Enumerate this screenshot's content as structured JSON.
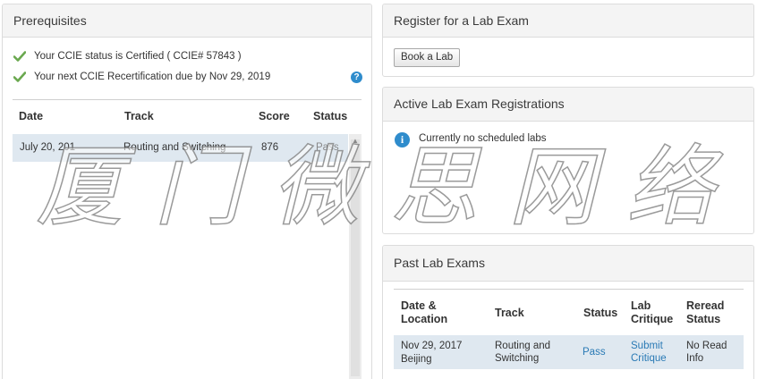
{
  "prerequisites": {
    "title": "Prerequisites",
    "status_line": "Your CCIE status is Certified ( CCIE# 57843 )",
    "recert_line": "Your next CCIE Recertification due by Nov 29, 2019",
    "help_icon": "question-icon",
    "table": {
      "headers": [
        "Date",
        "Track",
        "Score",
        "Status"
      ],
      "rows": [
        {
          "date": "July 20, 201",
          "track": "Routing and Switching",
          "score": "876",
          "status": "Pass"
        }
      ]
    }
  },
  "register": {
    "title": "Register for a Lab Exam",
    "book_button": "Book a Lab"
  },
  "active": {
    "title": "Active Lab Exam Registrations",
    "info_icon": "info-icon",
    "message": "Currently no scheduled labs"
  },
  "past": {
    "title": "Past Lab Exams",
    "headers": [
      "Date & Location",
      "Track",
      "Status",
      "Lab Critique",
      "Reread Status"
    ],
    "rows": [
      {
        "date": "Nov 29, 2017",
        "location": "Beijing",
        "track": "Routing and Switching",
        "status": "Pass",
        "critique": "Submit Critique",
        "reread": "No Read Info"
      }
    ]
  },
  "watermark": "厦门微思网络",
  "colors": {
    "accent": "#2a7ab5",
    "row_highlight": "#dfe8f0",
    "check_green": "#6aa84f",
    "panel_header": "#f4f4f4"
  }
}
